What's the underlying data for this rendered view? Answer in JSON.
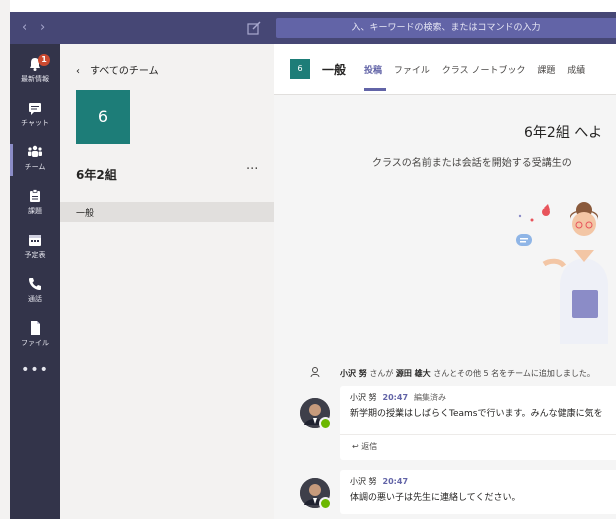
{
  "titlebar": {
    "back_glyph": "‹",
    "forward_glyph": "›",
    "search_placeholder": "入、キーワードの検索、またはコマンドの入力"
  },
  "rail": {
    "items": [
      {
        "label": "最新情報",
        "icon": "bell-icon",
        "badge": "1"
      },
      {
        "label": "チャット",
        "icon": "chat-icon"
      },
      {
        "label": "チーム",
        "icon": "teams-icon",
        "active": true
      },
      {
        "label": "課題",
        "icon": "assignments-icon"
      },
      {
        "label": "予定表",
        "icon": "calendar-icon"
      },
      {
        "label": "通話",
        "icon": "phone-icon"
      },
      {
        "label": "ファイル",
        "icon": "file-icon"
      }
    ],
    "more_glyph": "•••"
  },
  "team_panel": {
    "back_label": "‹　すべてのチーム",
    "tile_text": "6",
    "team_name": "6年2組",
    "more_glyph": "···",
    "channel": "一般"
  },
  "channel_header": {
    "tile_text": "6",
    "title": "一般",
    "tabs": [
      "投稿",
      "ファイル",
      "クラス ノートブック",
      "課題",
      "成績"
    ],
    "active_tab": 0
  },
  "welcome": {
    "title": "6年2組 へよ",
    "subtitle": "クラスの名前または会話を開始する受講生の"
  },
  "activity": {
    "actor": "小沢 努",
    "mid1": " さんが ",
    "target": "源田 雄大",
    "mid2": " さんとその他 5 名をチームに追加しました。"
  },
  "messages": [
    {
      "author": "小沢 努",
      "time": "20:47",
      "edited": "編集済み",
      "text": "新学期の授業はしばらくTeamsで行います。みんな健康に気を",
      "reply_label": "↩ 返信"
    },
    {
      "author": "小沢 努",
      "time": "20:47",
      "text": "体調の悪い子は先生に連絡してください。"
    }
  ],
  "colors": {
    "titlebar": "#464775",
    "rail": "#33344a",
    "accent": "#6264a7",
    "team_tile": "#1d7d78",
    "badge": "#cc4a31",
    "presence": "#6bb700"
  }
}
